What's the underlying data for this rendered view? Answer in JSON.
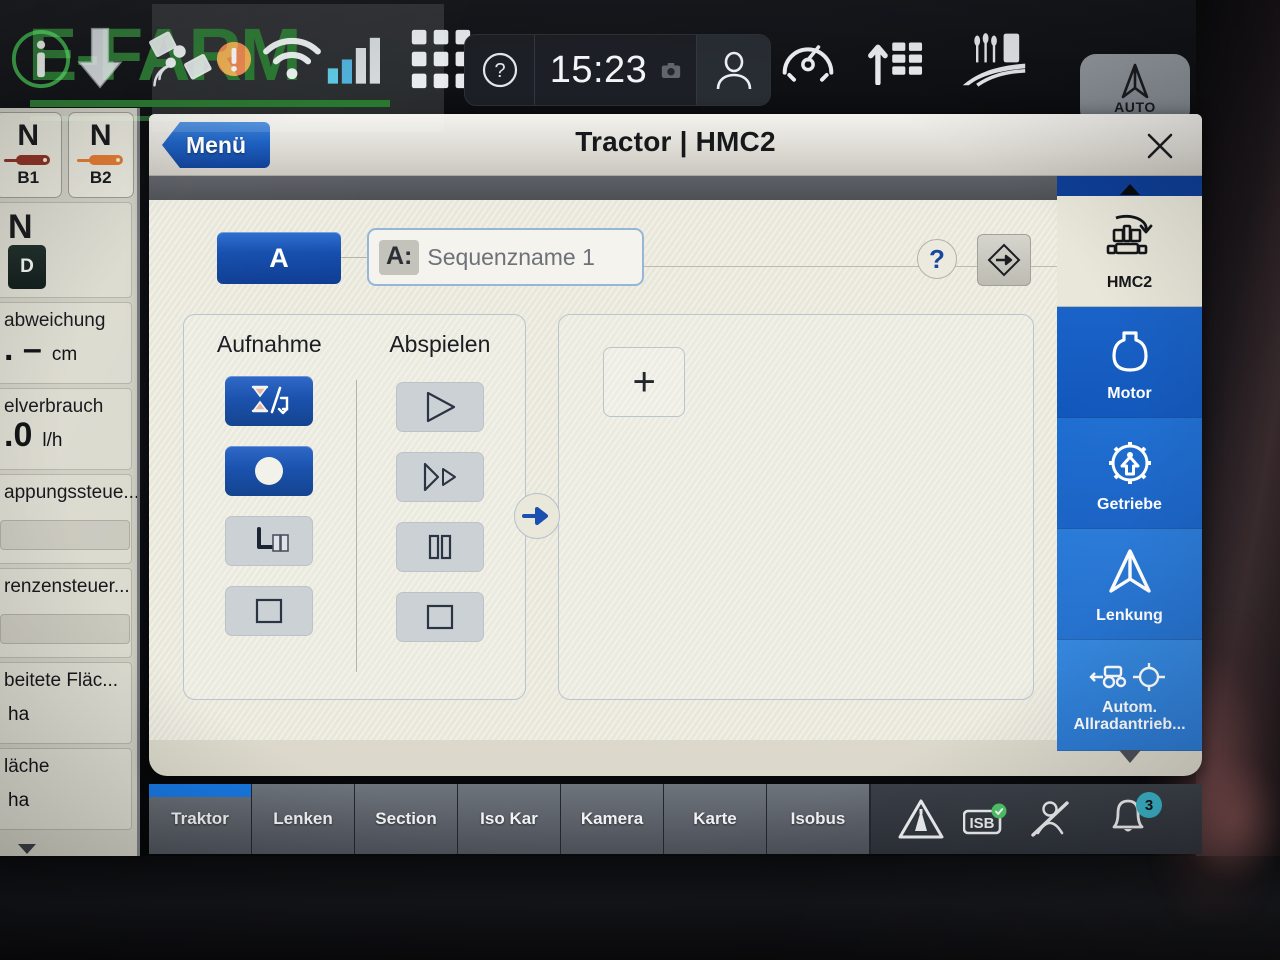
{
  "statusbar": {
    "time": "15:23",
    "icons": [
      {
        "name": "info-icon"
      },
      {
        "name": "download-arrow-icon"
      },
      {
        "name": "satellite-gps-icon"
      },
      {
        "name": "wifi-icon"
      },
      {
        "name": "signal-bars-icon"
      },
      {
        "name": "app-grid-icon"
      }
    ],
    "help_icon": "question-mark-icon",
    "camera_icon": "camera-icon",
    "user_icon": "user-profile-icon",
    "right_icons": [
      {
        "name": "performance-gauge-icon"
      },
      {
        "name": "implement-rows-icon"
      },
      {
        "name": "field-farm-icon"
      }
    ],
    "auto_button_label": "AUTO"
  },
  "watermark": {
    "text": "E-FARM"
  },
  "left_panel": {
    "gear_buttons": [
      {
        "gear": "N",
        "label": "B1"
      },
      {
        "gear": "N",
        "label": "B2"
      }
    ],
    "drive": {
      "gear": "N",
      "mode": "D"
    },
    "tiles": [
      {
        "label": "аbweichung",
        "value": ". –",
        "unit": "cm"
      },
      {
        "label": "elverbrauch",
        "value": ".0",
        "unit": "l/h"
      },
      {
        "label": "appungssteue...",
        "value": "",
        "unit": ""
      },
      {
        "label": "renzensteuer...",
        "value": "",
        "unit": ""
      },
      {
        "label": "beitete Fläc...",
        "value": "",
        "unit": "ha"
      },
      {
        "label": "läche",
        "value": "",
        "unit": "ha"
      }
    ]
  },
  "dialog": {
    "menu_button": "Menü",
    "title": "Tractor | HMC2",
    "close_icon": "close-x-icon",
    "sequence": {
      "letter_button": "A",
      "name_badge": "A:",
      "name_placeholder": "Sequenzname 1",
      "help_label": "?",
      "diamond_icon": "diamond-arrow-icon"
    },
    "controls": {
      "record_heading": "Aufnahme",
      "play_heading": "Abspielen",
      "record_buttons": [
        {
          "name": "timer-mode-toggle-button",
          "icon": "hourglass-slash-icon",
          "state": "active"
        },
        {
          "name": "record-button",
          "icon": "record-circle-icon",
          "state": "active"
        },
        {
          "name": "step-back-button",
          "icon": "step-return-icon",
          "state": "disabled"
        },
        {
          "name": "stop-record-button",
          "icon": "stop-square-icon",
          "state": "disabled"
        }
      ],
      "play_buttons": [
        {
          "name": "play-button",
          "icon": "play-triangle-icon",
          "state": "disabled"
        },
        {
          "name": "step-play-button",
          "icon": "step-play-icon",
          "state": "disabled"
        },
        {
          "name": "pause-button",
          "icon": "pause-bars-icon",
          "state": "disabled"
        },
        {
          "name": "stop-play-button",
          "icon": "stop-square-icon",
          "state": "disabled"
        }
      ],
      "flow_arrow_icon": "blue-right-arrow-icon"
    },
    "sequence_panel": {
      "add_button": "+"
    }
  },
  "sidebar": {
    "scroll_up_icon": "chevron-up-icon",
    "scroll_down_icon": "chevron-down-icon",
    "items": [
      {
        "label": "HMC2",
        "icon": "tractor-loop-icon",
        "selected": true
      },
      {
        "label": "Motor",
        "icon": "engine-icon",
        "selected": false
      },
      {
        "label": "Getriebe",
        "icon": "gear-transmission-icon",
        "selected": false
      },
      {
        "label": "Lenkung",
        "icon": "steering-icon",
        "selected": false
      },
      {
        "label": "Autom. Allradantrieb...",
        "icon": "awd-icon",
        "selected": false
      }
    ]
  },
  "tabbar": {
    "tabs": [
      {
        "label": "Traktor",
        "active": true
      },
      {
        "label": "Lenken",
        "active": false
      },
      {
        "label": "Section",
        "active": false
      },
      {
        "label": "Iso Kar",
        "active": false
      },
      {
        "label": "Kamera",
        "active": false
      },
      {
        "label": "Karte",
        "active": false
      },
      {
        "label": "Isobus",
        "active": false
      }
    ],
    "tray_icons": [
      {
        "name": "road-warning-icon"
      },
      {
        "name": "isb-badge-icon"
      },
      {
        "name": "hand-crossed-icon"
      }
    ],
    "notification_icon": "bell-icon",
    "notification_count": "3"
  },
  "colors": {
    "accent_blue": "#1b52ae",
    "tab_active": "#1877e0",
    "badge_cyan": "#39b6cc",
    "panel_bg": "#e9e7da",
    "watermark_green": "#1f7a22"
  }
}
